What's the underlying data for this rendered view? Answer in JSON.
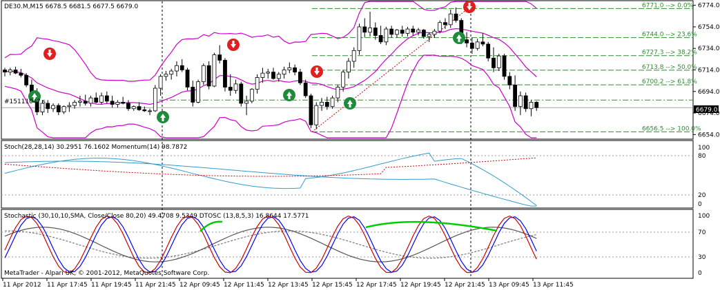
{
  "main": {
    "header": "DE30.M,M15  6678.5 6681.5 6677.5 6679.0",
    "price_label": "6679.0",
    "order_label": "#1511104? s",
    "yticks": [
      "6774.0",
      "6754.0",
      "6734.0",
      "6714.0",
      "6694.0",
      "6674.0",
      "6654.0"
    ]
  },
  "fib": [
    {
      "level": 6771.0,
      "label": "6771.0 --> 0.0%"
    },
    {
      "level": 6744.0,
      "label": "6744.0 --> 23.6%"
    },
    {
      "level": 6727.3,
      "label": "6727.3 --> 38.2%"
    },
    {
      "level": 6713.8,
      "label": "6713.8 --> 50.0%"
    },
    {
      "level": 6700.2,
      "label": "6700.2 --> 61.8%"
    },
    {
      "level": 6656.5,
      "label": "6656.5 --> 100.0%"
    }
  ],
  "ind1": {
    "header": "Stoch(28,28,14) 30.2951 76.1602  Momentum(14) 98.7872",
    "yticks": [
      "100",
      "80",
      "20",
      "0"
    ]
  },
  "ind2": {
    "header": "Stochastic (30,10,10,SMA, Close/Close 80,20) 49.4708 9.5349  DTOSC (13,8,5,3) 16.8644 17.5771",
    "yticks": [
      "100",
      "70",
      "30",
      "0"
    ]
  },
  "xaxis": {
    "ticks": [
      "11 Apr 2012",
      "11 Apr 17:45",
      "11 Apr 19:45",
      "11 Apr 21:45",
      "12 Apr 09:45",
      "12 Apr 11:45",
      "12 Apr 13:45",
      "12 Apr 15:45",
      "12 Apr 17:45",
      "12 Apr 19:45",
      "12 Apr 21:45",
      "13 Apr 09:45",
      "13 Apr 11:45"
    ]
  },
  "copyright": "MetaTrader - Alpari UK, © 2001-2012, MetaQuotes Software Corp.",
  "colors": {
    "bull": "#ffffff",
    "bear": "#000000",
    "band": "#cc00cc",
    "fib": "#2e8b2e",
    "stoch_blue": "#0000ff",
    "stoch_red": "#cc0000",
    "green": "#00cc00",
    "teal": "#3399cc"
  },
  "chart_data": {
    "type": "candlestick",
    "ylim": [
      6651,
      6777
    ],
    "candles": [
      [
        6714,
        6716,
        6708,
        6712
      ],
      [
        6712,
        6716,
        6709,
        6714
      ],
      [
        6714,
        6717,
        6710,
        6711
      ],
      [
        6711,
        6715,
        6707,
        6709
      ],
      [
        6709,
        6711,
        6698,
        6700
      ],
      [
        6700,
        6705,
        6690,
        6693
      ],
      [
        6693,
        6697,
        6672,
        6675
      ],
      [
        6675,
        6686,
        6672,
        6683
      ],
      [
        6683,
        6686,
        6674,
        6678
      ],
      [
        6678,
        6683,
        6675,
        6681
      ],
      [
        6681,
        6683,
        6672,
        6675
      ],
      [
        6675,
        6681,
        6673,
        6680
      ],
      [
        6680,
        6684,
        6675,
        6681
      ],
      [
        6681,
        6686,
        6678,
        6684
      ],
      [
        6684,
        6690,
        6680,
        6685
      ],
      [
        6685,
        6691,
        6681,
        6683
      ],
      [
        6683,
        6690,
        6680,
        6688
      ],
      [
        6688,
        6693,
        6683,
        6684
      ],
      [
        6684,
        6693,
        6682,
        6690
      ],
      [
        6690,
        6694,
        6683,
        6685
      ],
      [
        6685,
        6690,
        6679,
        6682
      ],
      [
        6682,
        6686,
        6679,
        6684
      ],
      [
        6684,
        6689,
        6682,
        6683
      ],
      [
        6683,
        6686,
        6676,
        6678
      ],
      [
        6678,
        6681,
        6676,
        6680
      ],
      [
        6680,
        6684,
        6676,
        6677
      ],
      [
        6677,
        6680,
        6675,
        6676
      ],
      [
        6676,
        6678,
        6672,
        6676
      ],
      [
        6676,
        6700,
        6675,
        6697
      ],
      [
        6697,
        6710,
        6690,
        6708
      ],
      [
        6708,
        6713,
        6704,
        6710
      ],
      [
        6710,
        6715,
        6705,
        6713
      ],
      [
        6713,
        6722,
        6708,
        6718
      ],
      [
        6718,
        6724,
        6712,
        6714
      ],
      [
        6714,
        6716,
        6695,
        6698
      ],
      [
        6698,
        6704,
        6680,
        6684
      ],
      [
        6684,
        6705,
        6683,
        6703
      ],
      [
        6703,
        6720,
        6700,
        6718
      ],
      [
        6718,
        6722,
        6696,
        6699
      ],
      [
        6699,
        6730,
        6698,
        6728
      ],
      [
        6728,
        6737,
        6720,
        6723
      ],
      [
        6723,
        6725,
        6694,
        6698
      ],
      [
        6698,
        6710,
        6690,
        6695
      ],
      [
        6695,
        6705,
        6692,
        6701
      ],
      [
        6701,
        6703,
        6680,
        6683
      ],
      [
        6683,
        6690,
        6672,
        6685
      ],
      [
        6685,
        6697,
        6683,
        6696
      ],
      [
        6696,
        6710,
        6692,
        6707
      ],
      [
        6707,
        6716,
        6702,
        6711
      ],
      [
        6711,
        6715,
        6706,
        6712
      ],
      [
        6712,
        6716,
        6705,
        6706
      ],
      [
        6706,
        6712,
        6703,
        6710
      ],
      [
        6710,
        6717,
        6706,
        6714
      ],
      [
        6714,
        6721,
        6711,
        6716
      ],
      [
        6716,
        6719,
        6709,
        6712
      ],
      [
        6712,
        6715,
        6700,
        6702
      ],
      [
        6702,
        6705,
        6688,
        6690
      ],
      [
        6690,
        6692,
        6660,
        6663
      ],
      [
        6663,
        6684,
        6659,
        6681
      ],
      [
        6681,
        6688,
        6676,
        6684
      ],
      [
        6684,
        6689,
        6677,
        6680
      ],
      [
        6680,
        6690,
        6678,
        6688
      ],
      [
        6688,
        6700,
        6684,
        6698
      ],
      [
        6698,
        6714,
        6694,
        6712
      ],
      [
        6712,
        6725,
        6706,
        6722
      ],
      [
        6722,
        6735,
        6716,
        6732
      ],
      [
        6732,
        6757,
        6728,
        6754
      ],
      [
        6754,
        6762,
        6744,
        6749
      ],
      [
        6749,
        6768,
        6745,
        6753
      ],
      [
        6753,
        6758,
        6742,
        6746
      ],
      [
        6746,
        6755,
        6738,
        6740
      ],
      [
        6740,
        6754,
        6737,
        6752
      ],
      [
        6752,
        6755,
        6744,
        6747
      ],
      [
        6747,
        6752,
        6744,
        6751
      ],
      [
        6751,
        6755,
        6745,
        6748
      ],
      [
        6748,
        6754,
        6745,
        6752
      ],
      [
        6752,
        6755,
        6746,
        6749
      ],
      [
        6749,
        6753,
        6746,
        6751
      ],
      [
        6751,
        6752,
        6743,
        6745
      ],
      [
        6745,
        6749,
        6740,
        6747
      ],
      [
        6747,
        6752,
        6744,
        6750
      ],
      [
        6750,
        6760,
        6748,
        6758
      ],
      [
        6758,
        6762,
        6752,
        6756
      ],
      [
        6756,
        6770,
        6753,
        6766
      ],
      [
        6766,
        6772,
        6758,
        6760
      ],
      [
        6760,
        6762,
        6738,
        6742
      ],
      [
        6742,
        6749,
        6735,
        6739
      ],
      [
        6739,
        6744,
        6729,
        6734
      ],
      [
        6734,
        6743,
        6732,
        6740
      ],
      [
        6740,
        6748,
        6736,
        6738
      ],
      [
        6738,
        6740,
        6722,
        6725
      ],
      [
        6725,
        6735,
        6712,
        6716
      ],
      [
        6716,
        6729,
        6713,
        6727
      ],
      [
        6727,
        6729,
        6705,
        6708
      ],
      [
        6708,
        6712,
        6696,
        6700
      ],
      [
        6700,
        6709,
        6676,
        6680
      ],
      [
        6680,
        6694,
        6672,
        6690
      ],
      [
        6690,
        6693,
        6675,
        6678
      ],
      [
        6678,
        6686,
        6671,
        6684
      ],
      [
        6684,
        6685,
        6676,
        6679
      ]
    ]
  }
}
